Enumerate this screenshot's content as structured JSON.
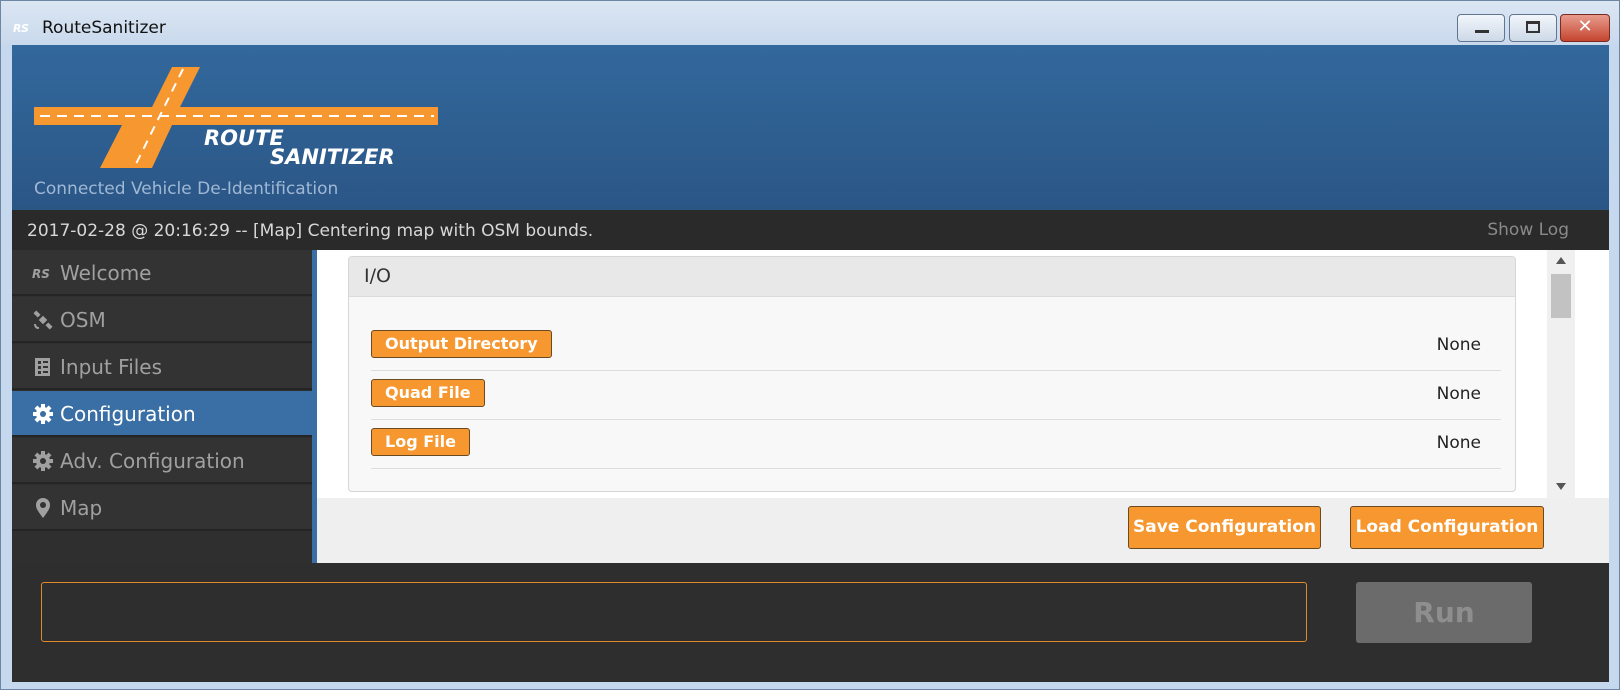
{
  "window": {
    "icon_text": "RS",
    "title": "RouteSanitizer"
  },
  "header": {
    "logo_line1": "ROUTE",
    "logo_line2": "SANITIZER",
    "subtitle": "Connected Vehicle De-Identification"
  },
  "status": {
    "message": "2017-02-28 @ 20:16:29 -- [Map] Centering map with OSM bounds.",
    "show_log": "Show Log"
  },
  "sidebar": {
    "items": [
      {
        "label": "Welcome",
        "icon": "rs-logo-icon",
        "active": false
      },
      {
        "label": "OSM",
        "icon": "satellite-icon",
        "active": false
      },
      {
        "label": "Input Files",
        "icon": "file-icon",
        "active": false
      },
      {
        "label": "Configuration",
        "icon": "gear-icon",
        "active": true
      },
      {
        "label": "Adv. Configuration",
        "icon": "gear-icon",
        "active": false
      },
      {
        "label": "Map",
        "icon": "map-pin-icon",
        "active": false
      }
    ]
  },
  "io_panel": {
    "title": "I/O",
    "rows": [
      {
        "button": "Output Directory",
        "value": "None"
      },
      {
        "button": "Quad File",
        "value": "None"
      },
      {
        "button": "Log File",
        "value": "None"
      }
    ]
  },
  "actions": {
    "save": "Save Configuration",
    "load": "Load Configuration"
  },
  "bottom": {
    "input_value": "",
    "run": "Run"
  },
  "colors": {
    "accent_orange": "#f7972f",
    "header_blue": "#2f5f92",
    "active_nav": "#3a6fa5"
  }
}
